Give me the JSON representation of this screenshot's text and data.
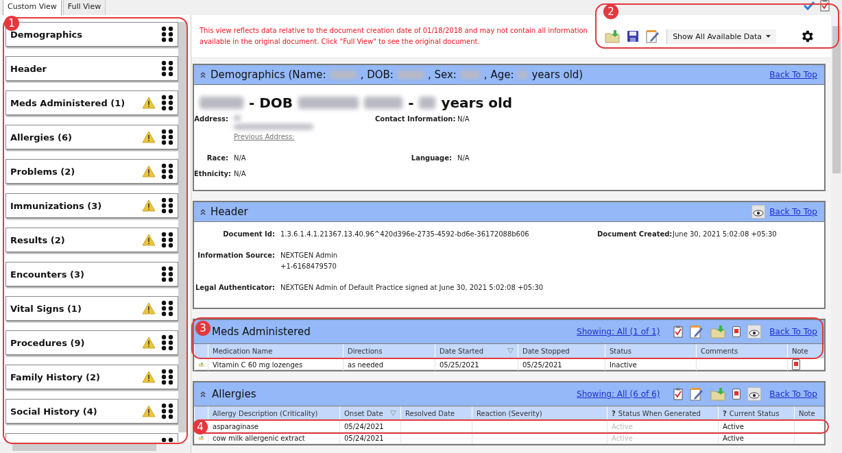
{
  "tabs": [
    {
      "label": "Custom View",
      "selected": true
    },
    {
      "label": "Full View",
      "selected": false
    }
  ],
  "sidebar": {
    "items": [
      {
        "kind": "card",
        "label": "Demographics",
        "warning": false
      },
      {
        "kind": "card",
        "label": "Header",
        "warning": false
      },
      {
        "kind": "card",
        "label": "Meds Administered (1)",
        "warning": true
      },
      {
        "kind": "card",
        "label": "Allergies (6)",
        "warning": true
      },
      {
        "kind": "card",
        "label": "Problems (2)",
        "warning": true
      },
      {
        "kind": "card",
        "label": "Immunizations (3)",
        "warning": true
      },
      {
        "kind": "card",
        "label": "Results (2)",
        "warning": true
      },
      {
        "kind": "card",
        "label": "Encounters (3)",
        "warning": false
      },
      {
        "kind": "card",
        "label": "Vital Signs (1)",
        "warning": true
      },
      {
        "kind": "card",
        "label": "Procedures (9)",
        "warning": true
      },
      {
        "kind": "card",
        "label": "Family History (2)",
        "warning": true
      },
      {
        "kind": "card",
        "label": "Social History (4)",
        "warning": true
      },
      {
        "kind": "partial"
      }
    ]
  },
  "notice": "This view reflects data relative to the document creation date of 01/18/2018 and may not contain all information available in the original document. Click \"Full View\" to see the original document.",
  "toolbar": {
    "dropdown": "Show All Available Data"
  },
  "demographics": {
    "title_parts": [
      {
        "kind": "text",
        "text": "Demographics (Name:"
      },
      {
        "kind": "blur"
      },
      {
        "kind": "text",
        "text": ", DOB:"
      },
      {
        "kind": "blur"
      },
      {
        "kind": "text",
        "text": ", Sex:"
      },
      {
        "kind": "blur"
      },
      {
        "kind": "text",
        "text": ", Age:"
      },
      {
        "kind": "blur"
      },
      {
        "kind": "text",
        "text": "years old)"
      }
    ],
    "back_link": "Back To Top",
    "headline_parts": [
      {
        "kind": "blur"
      },
      {
        "kind": "text",
        "text": "- DOB"
      },
      {
        "kind": "blur"
      },
      {
        "kind": "blur"
      },
      {
        "kind": "text",
        "text": "-"
      },
      {
        "kind": "blur"
      },
      {
        "kind": "text",
        "text": "years old"
      }
    ],
    "address_label": "Address:",
    "previous_address": "Previous Address:",
    "contact_label": "Contact Information:",
    "contact_value": "N/A",
    "race_label": "Race:",
    "race_value": "N/A",
    "language_label": "Language:",
    "language_value": "N/A",
    "ethnicity_label": "Ethnicity:",
    "ethnicity_value": "N/A"
  },
  "header": {
    "title": "Header",
    "back_link": "Back To Top",
    "fields": [
      {
        "label": "Document Id:",
        "lines": [
          "1.3.6.1.4.1.21367.13.40.96^420d396e-2735-4592-bd6e-36172088b606"
        ],
        "side_label": "Document Created:",
        "side_value": "June 30, 2021 5:02:08 +05:30"
      },
      {
        "label": "Information Source:",
        "lines": [
          "NEXTGEN Admin",
          "+1-6168479570"
        ]
      },
      {
        "label": "Legal Authenticator:",
        "lines": [
          "NEXTGEN Admin of Default Practice signed at June 30, 2021 5:02:08 +05:30"
        ]
      }
    ]
  },
  "tables": [
    {
      "title": "Meds Administered",
      "showing": "Showing: All (1 of 1)",
      "back_link": "Back To Top",
      "collapse_arrow": false,
      "columns": [
        {
          "label": "Medication Name",
          "filter": false
        },
        {
          "label": "Directions",
          "filter": false
        },
        {
          "label": "Date Started",
          "filter": true
        },
        {
          "label": "Date Stopped",
          "filter": false
        },
        {
          "label": "Status",
          "filter": false
        },
        {
          "label": "Comments",
          "filter": false
        },
        {
          "label": "Note",
          "filter": false
        }
      ],
      "rows": [
        {
          "cells": [
            "Vitamin C 60 mg lozenges",
            "as needed",
            "05/25/2021",
            "05/25/2021",
            "Inactive",
            ""
          ],
          "note": true,
          "row_icon": true
        }
      ]
    },
    {
      "title": "Allergies",
      "showing": "Showing: All (6 of 6)",
      "back_link": "Back To Top",
      "collapse_arrow": true,
      "columns": [
        {
          "label": "Allergy Description (Criticality)",
          "filter": false
        },
        {
          "label": "Onset Date",
          "filter": true
        },
        {
          "label": "Resolved Date",
          "filter": false
        },
        {
          "label": "Reaction (Severity)",
          "filter": false
        },
        {
          "label": "Status When Generated",
          "filter": false,
          "help_mark": "?"
        },
        {
          "label": "Current Status",
          "filter": false,
          "help_mark": "?"
        },
        {
          "label": "Note",
          "filter": false
        }
      ],
      "rows": [
        {
          "cells": [
            "asparaginase",
            "05/24/2021",
            "",
            "",
            "Active",
            "Active"
          ],
          "note": false,
          "row_icon": false
        },
        {
          "cells": [
            "cow milk allergenic extract",
            "05/24/2021",
            "",
            "",
            "Active",
            "Active"
          ],
          "note": false,
          "row_icon": true
        }
      ]
    }
  ],
  "callouts": [
    {
      "number": "1"
    },
    {
      "number": "2"
    },
    {
      "number": "3"
    },
    {
      "number": "4"
    }
  ]
}
